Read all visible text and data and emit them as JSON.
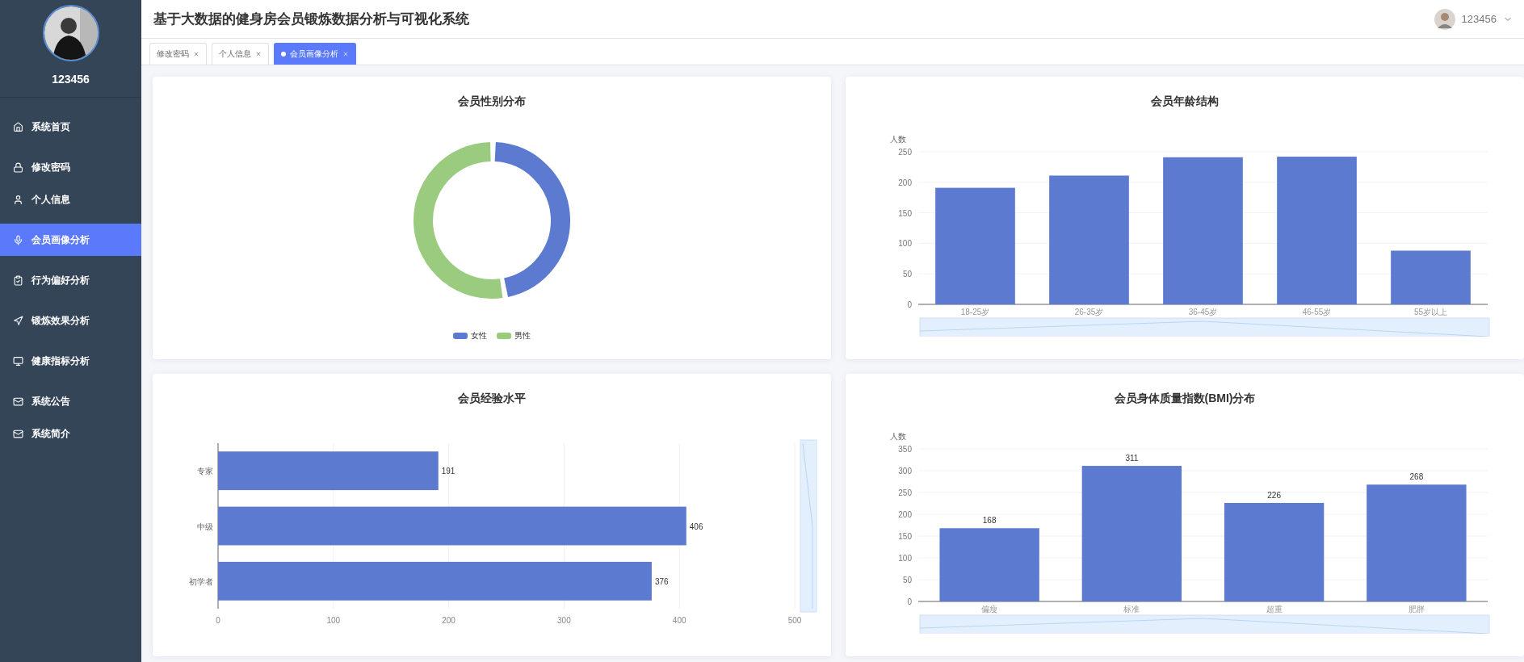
{
  "sidebar": {
    "username": "123456",
    "items": [
      {
        "label": "系统首页",
        "selected": false
      },
      {
        "label": "修改密码",
        "selected": false
      },
      {
        "label": "个人信息",
        "selected": false
      },
      {
        "label": "会员画像分析",
        "selected": true
      },
      {
        "label": "行为偏好分析",
        "selected": false
      },
      {
        "label": "锻炼效果分析",
        "selected": false
      },
      {
        "label": "健康指标分析",
        "selected": false
      },
      {
        "label": "系统公告",
        "selected": false
      },
      {
        "label": "系统简介",
        "selected": false
      }
    ]
  },
  "header": {
    "title": "基于大数据的健身房会员锻炼数据分析与可视化系统",
    "user": "123456"
  },
  "tabs": [
    {
      "label": "修改密码",
      "selected": false
    },
    {
      "label": "个人信息",
      "selected": false
    },
    {
      "label": "会员画像分析",
      "selected": true
    }
  ],
  "cards": [
    {
      "kind": "donut",
      "title": "会员性别分布",
      "legend": [
        {
          "label": "女性",
          "color": "#5c7bd0"
        },
        {
          "label": "男性",
          "color": "#9bcb7f"
        }
      ]
    },
    {
      "kind": "bar",
      "title": "会员年龄结构",
      "chart_data": {
        "type": "bar",
        "ylabel": "人数",
        "categories": [
          "18-25岁",
          "26-35岁",
          "36-45岁",
          "46-55岁",
          "55岁以上"
        ],
        "series": [
          {
            "color": "#5c7bd0",
            "values": [
              191,
              211,
              241,
              242,
              88
            ]
          }
        ],
        "ylim": [
          0,
          250
        ],
        "yticks": [
          0,
          50,
          100,
          150,
          200,
          250
        ],
        "grid": true
      }
    },
    {
      "kind": "bar",
      "title": "会员经验水平",
      "chart_data": {
        "type": "bar",
        "orientation": "horizontal",
        "categories": [
          "专家",
          "中级",
          "初学者"
        ],
        "series": [
          {
            "color": "#5c7bd0",
            "values": [
              191,
              406,
              376
            ]
          }
        ],
        "xlim": [
          0,
          500
        ],
        "xticks": [
          0,
          100,
          200,
          300,
          400,
          500
        ],
        "data_labels": true,
        "grid": true
      }
    },
    {
      "kind": "bar",
      "title": "会员身体质量指数(BMI)分布",
      "chart_data": {
        "type": "bar",
        "ylabel": "人数",
        "categories": [
          "偏瘦",
          "标准",
          "超重",
          "肥胖"
        ],
        "series": [
          {
            "color": "#5c7bd0",
            "values": [
              168,
              311,
              226,
              268
            ]
          }
        ],
        "ylim": [
          0,
          350
        ],
        "yticks": [
          0,
          50,
          100,
          150,
          200,
          250,
          300,
          350
        ],
        "data_labels": true,
        "grid": true
      }
    }
  ]
}
